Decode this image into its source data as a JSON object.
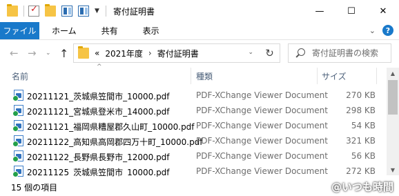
{
  "window": {
    "title": "寄付証明書",
    "controls": {
      "minimize": "—",
      "maximize": "☐",
      "close": "✕"
    }
  },
  "quick_access": {
    "icons": [
      "folder-icon",
      "properties-check-icon",
      "new-folder-icon",
      "view-details-icon",
      "view-preview-icon",
      "customize-dropdown-icon"
    ]
  },
  "ribbon": {
    "file_tab": "ファイル",
    "tabs": [
      "ホーム",
      "共有",
      "表示"
    ],
    "expand_chevron": "⌄",
    "help": "?"
  },
  "navigation": {
    "back": "←",
    "forward": "→",
    "recent_dropdown": "⌄",
    "up": "↑",
    "breadcrumb": [
      "2021年度",
      "寄付証明書"
    ],
    "overflow": "«",
    "separator": "›",
    "refresh": "↻",
    "address_dropdown": "⌄"
  },
  "search": {
    "placeholder": "寄付証明書の検索"
  },
  "columns": {
    "name": "名前",
    "type": "種類",
    "size": "サイズ",
    "sort_indicator": "^"
  },
  "files": [
    {
      "name": "20211121_茨城県笠間市_10000.pdf",
      "type": "PDF-XChange Viewer Document",
      "size": "270 KB"
    },
    {
      "name": "20211121_宮城県登米市_14000.pdf",
      "type": "PDF-XChange Viewer Document",
      "size": "298 KB"
    },
    {
      "name": "20211121_福岡県糟屋郡久山町_10000.pdf",
      "type": "PDF-XChange Viewer Document",
      "size": "54 KB"
    },
    {
      "name": "20211122_高知県高岡郡四万十町_10000.pdf",
      "type": "PDF-XChange Viewer Document",
      "size": "321 KB"
    },
    {
      "name": "20211122_長野県長野市_12000.pdf",
      "type": "PDF-XChange Viewer Document",
      "size": "56 KB"
    },
    {
      "name": "20211125_茨城県笠間市_10000.pdf",
      "type": "PDF-XChange Viewer Document",
      "size": "272 KB"
    }
  ],
  "scrollbar": {
    "up": "▲",
    "down": "▼"
  },
  "status": {
    "item_count": "15 個の項目",
    "watermark": "@いつも時間"
  },
  "colors": {
    "accent": "#1979ca",
    "header_text": "#4c607a",
    "secondary_text": "#6d6d6d"
  }
}
